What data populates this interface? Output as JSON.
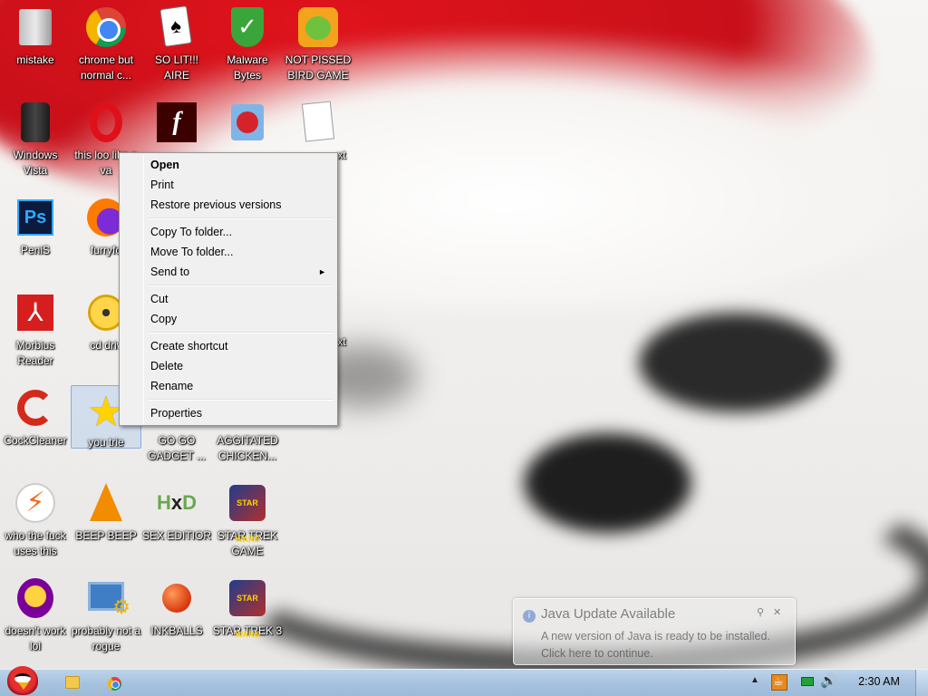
{
  "desktop": {
    "icons": [
      {
        "label": "mistake",
        "icon": "install-icon"
      },
      {
        "label": "chrome but normal c...",
        "icon": "chrome-icon"
      },
      {
        "label": "SO LIT!!! AIRE",
        "icon": "playing-card-icon"
      },
      {
        "label": "Malware Bytes",
        "icon": "shield-check-icon"
      },
      {
        "label": "NOT PISSED BIRD GAME",
        "icon": "green-pig-icon"
      },
      {
        "label": "Windows Vista",
        "icon": "trash-bin-icon"
      },
      {
        "label": "this loo like a va",
        "icon": "opera-icon"
      },
      {
        "label": "PeniS",
        "icon": "photoshop-icon"
      },
      {
        "label": "furryfo",
        "icon": "firefox-icon"
      },
      {
        "label": "Morbius Reader",
        "icon": "acrobat-icon"
      },
      {
        "label": "cd driv",
        "icon": "cd-icon"
      },
      {
        "label": "CockCleaner",
        "icon": "ccleaner-icon"
      },
      {
        "label": "you trie",
        "icon": "star-icon"
      },
      {
        "label": "GO GO GADGET ...",
        "icon": "gadget-icon"
      },
      {
        "label": "AGGITATED CHICKEN...",
        "icon": "angry-bird-icon"
      },
      {
        "label": "who the fuck uses this",
        "icon": "lightning-icon"
      },
      {
        "label": "BEEP BEEP",
        "icon": "vlc-cone-icon"
      },
      {
        "label": "SEX EDITIOR",
        "icon": "hxd-icon"
      },
      {
        "label": "STAR TREK GAME",
        "icon": "star-trek-icon"
      },
      {
        "label": "doesn't work lol",
        "icon": "yahoo-messenger-icon"
      },
      {
        "label": "probably not a rogue",
        "icon": "monitor-gear-icon"
      },
      {
        "label": "INKBALLS",
        "icon": "inkball-icon"
      },
      {
        "label": "STAR TREK 3",
        "icon": "star-trek-icon"
      }
    ],
    "partial_labels": [
      "xt",
      "xt"
    ]
  },
  "context_menu": {
    "open": "Open",
    "print": "Print",
    "restore": "Restore previous versions",
    "copy_to": "Copy To folder...",
    "move_to": "Move To folder...",
    "send_to": "Send to",
    "send_to_arrow": "►",
    "cut": "Cut",
    "copy": "Copy",
    "create_shortcut": "Create shortcut",
    "delete": "Delete",
    "rename": "Rename",
    "properties": "Properties"
  },
  "notification": {
    "title": "Java Update Available",
    "line1": "A new version of Java is ready to be installed.",
    "line2": "Click here to continue.",
    "options_glyph": "⚲",
    "close_glyph": "✕",
    "info_glyph": "i"
  },
  "taskbar": {
    "tray_arrow": "▲",
    "volume_glyph": "🔊",
    "clock": "2:30 AM"
  }
}
